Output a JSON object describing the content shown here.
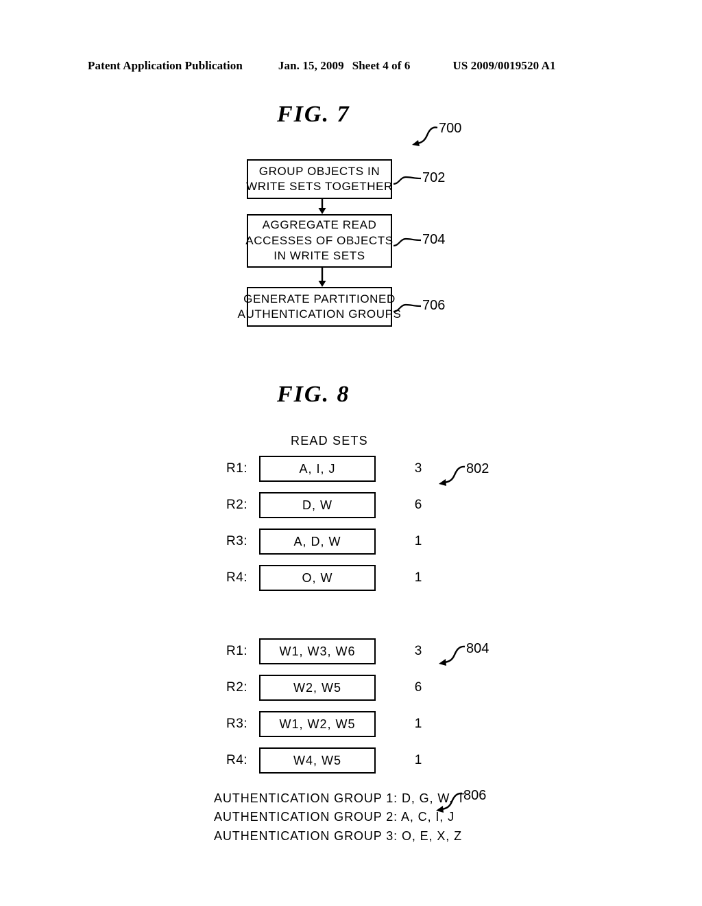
{
  "header": {
    "publication": "Patent Application Publication",
    "date": "Jan. 15, 2009",
    "sheet": "Sheet 4 of 6",
    "patent_number": "US 2009/0019520 A1"
  },
  "figure7": {
    "caption": "FIG.  7",
    "diagram_ref": "700",
    "steps": [
      {
        "ref": "702",
        "lines": [
          "GROUP OBJECTS IN",
          "WRITE SETS TOGETHER"
        ]
      },
      {
        "ref": "704",
        "lines": [
          "AGGREGATE READ",
          "ACCESSES OF OBJECTS",
          "IN WRITE SETS"
        ]
      },
      {
        "ref": "706",
        "lines": [
          "GENERATE PARTITIONED",
          "AUTHENTICATION GROUPS"
        ]
      }
    ]
  },
  "figure8": {
    "caption": "FIG.  8",
    "read_sets": {
      "title": "READ SETS",
      "ref": "802",
      "rows": [
        {
          "label": "R1:",
          "contents": "A, I, J",
          "count": "3"
        },
        {
          "label": "R2:",
          "contents": "D, W",
          "count": "6"
        },
        {
          "label": "R3:",
          "contents": "A, D, W",
          "count": "1"
        },
        {
          "label": "R4:",
          "contents": "O, W",
          "count": "1"
        }
      ]
    },
    "write_sets": {
      "ref": "804",
      "rows": [
        {
          "label": "R1:",
          "contents": "W1, W3, W6",
          "count": "3"
        },
        {
          "label": "R2:",
          "contents": "W2, W5",
          "count": "6"
        },
        {
          "label": "R3:",
          "contents": "W1, W2, W5",
          "count": "1"
        },
        {
          "label": "R4:",
          "contents": "W4, W5",
          "count": "1"
        }
      ]
    },
    "authentication_groups": {
      "ref": "806",
      "lines": [
        "AUTHENTICATION GROUP 1: D, G, W, T",
        "AUTHENTICATION GROUP 2: A, C, I, J",
        "AUTHENTICATION GROUP 3: O, E, X, Z"
      ]
    }
  }
}
